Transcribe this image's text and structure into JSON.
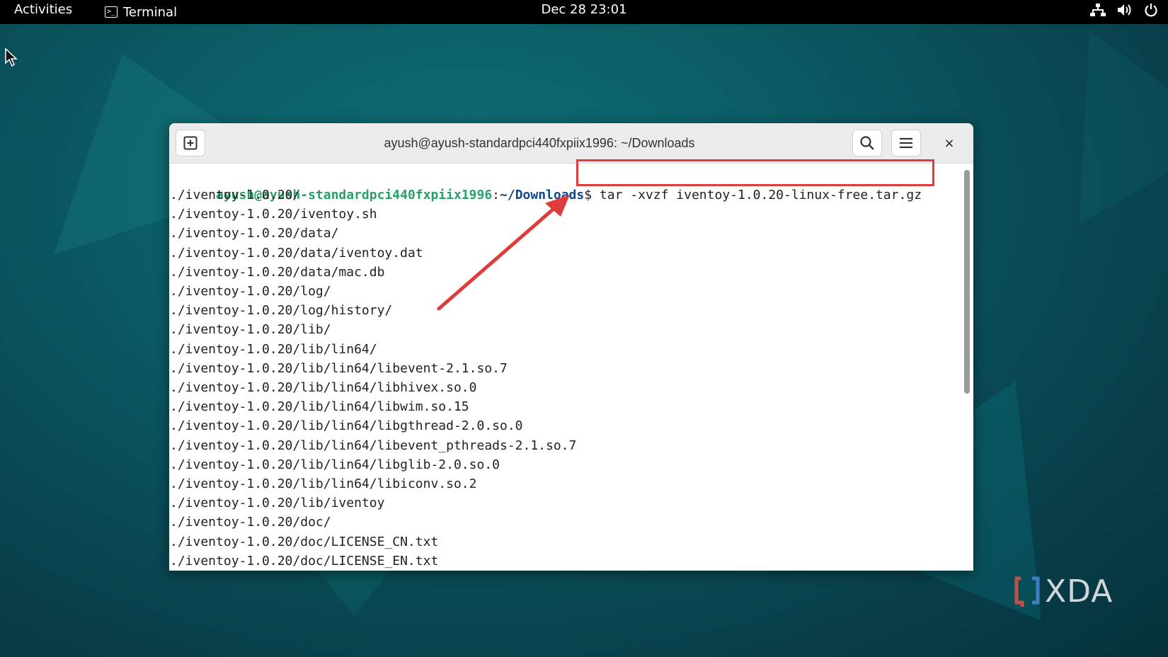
{
  "topbar": {
    "activities": "Activities",
    "app_name": "Terminal",
    "clock": "Dec 28  23:01",
    "status_icons": [
      "network-icon",
      "volume-icon",
      "power-icon"
    ]
  },
  "terminal": {
    "title": "ayush@ayush-standardpci440fxpiix1996: ~/Downloads",
    "prompt_user": "ayush@ayush-standardpci440fxpiix1996",
    "prompt_sep": ":",
    "prompt_path": "~/Downloads",
    "prompt_symbol": "$ ",
    "command": "tar -xvzf iventoy-1.0.20-linux-free.tar.gz",
    "output": [
      "./iventoy-1.0.20/",
      "./iventoy-1.0.20/iventoy.sh",
      "./iventoy-1.0.20/data/",
      "./iventoy-1.0.20/data/iventoy.dat",
      "./iventoy-1.0.20/data/mac.db",
      "./iventoy-1.0.20/log/",
      "./iventoy-1.0.20/log/history/",
      "./iventoy-1.0.20/lib/",
      "./iventoy-1.0.20/lib/lin64/",
      "./iventoy-1.0.20/lib/lin64/libevent-2.1.so.7",
      "./iventoy-1.0.20/lib/lin64/libhivex.so.0",
      "./iventoy-1.0.20/lib/lin64/libwim.so.15",
      "./iventoy-1.0.20/lib/lin64/libgthread-2.0.so.0",
      "./iventoy-1.0.20/lib/lin64/libevent_pthreads-2.1.so.7",
      "./iventoy-1.0.20/lib/lin64/libglib-2.0.so.0",
      "./iventoy-1.0.20/lib/lin64/libiconv.so.2",
      "./iventoy-1.0.20/lib/iventoy",
      "./iventoy-1.0.20/doc/",
      "./iventoy-1.0.20/doc/LICENSE_CN.txt",
      "./iventoy-1.0.20/doc/LICENSE_EN.txt"
    ],
    "close_label": "×"
  },
  "annotation": {
    "highlight_color": "#e03c3c"
  },
  "watermark": {
    "text": "XDA"
  },
  "colors": {
    "prompt_user": "#26a269",
    "prompt_path": "#12488b",
    "topbar": "#000000",
    "desktop": "#0b5b63"
  }
}
